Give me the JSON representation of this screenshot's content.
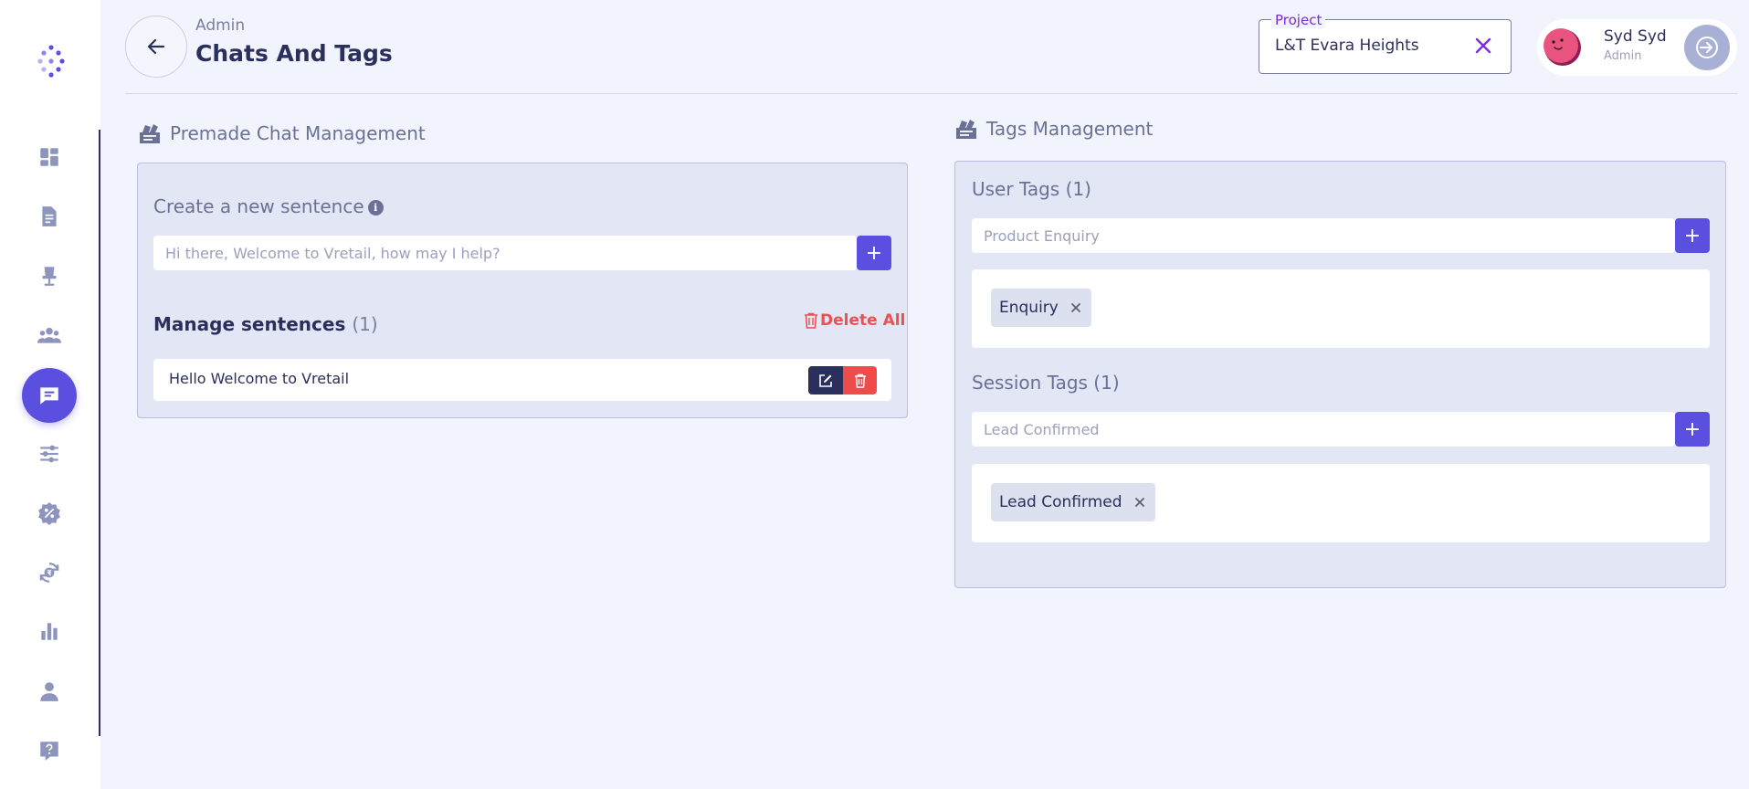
{
  "sidebar": {
    "items": [
      {
        "icon": "dashboard-icon",
        "active": false
      },
      {
        "icon": "document-icon",
        "active": false
      },
      {
        "icon": "chair-icon",
        "active": false
      },
      {
        "icon": "team-icon",
        "active": false
      },
      {
        "icon": "chat-icon",
        "active": true
      },
      {
        "icon": "sliders-icon",
        "active": false
      },
      {
        "icon": "discount-icon",
        "active": false
      },
      {
        "icon": "rupee-refresh-icon",
        "active": false
      },
      {
        "icon": "bar-chart-icon",
        "active": false
      },
      {
        "icon": "user-icon",
        "active": false
      },
      {
        "icon": "help-icon",
        "active": false
      }
    ]
  },
  "header": {
    "breadcrumb": "Admin",
    "title": "Chats And Tags",
    "project": {
      "label": "Project",
      "value": "L&T Evara Heights"
    },
    "user": {
      "name": "Syd Syd",
      "role": "Admin"
    }
  },
  "premade": {
    "section_title": "Premade Chat Management",
    "create_label": "Create a new sentence",
    "info_glyph": "i",
    "input_placeholder": "Hi there, Welcome to Vretail, how may I help?",
    "add_label": "+",
    "manage_label": "Manage sentences",
    "manage_count": "(1)",
    "delete_all_label": "Delete All",
    "sentences": [
      "Hello Welcome to Vretail"
    ]
  },
  "tags": {
    "section_title": "Tags Management",
    "user_tags": {
      "label": "User Tags (1)",
      "input_placeholder": "Product Enquiry",
      "add_label": "+",
      "chips": [
        "Enquiry"
      ]
    },
    "session_tags": {
      "label": "Session Tags (1)",
      "input_placeholder": "Lead Confirmed",
      "add_label": "+",
      "chips": [
        "Lead Confirmed"
      ]
    }
  },
  "colors": {
    "accent": "#5b4fe0",
    "navy": "#2a2f5b",
    "danger": "#ef4b4b",
    "panel": "#e2e6f5",
    "background": "#f1f4fd"
  }
}
